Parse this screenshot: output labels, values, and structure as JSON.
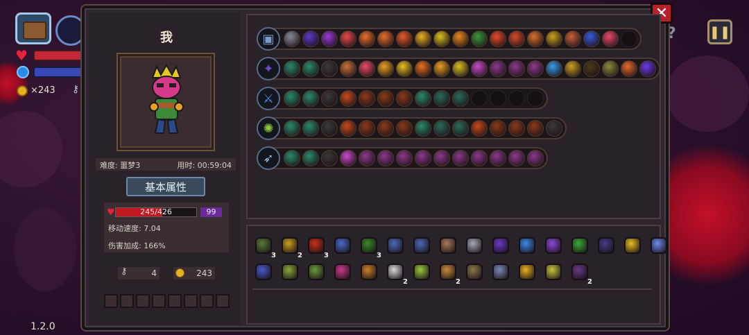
{
  "hud": {
    "coins": "×243",
    "version": "1.2.0"
  },
  "character": {
    "name": "我",
    "difficulty": "难度: 噩梦3",
    "time": "用时: 00:59:04",
    "stats_button": "基本属性",
    "hp": "245/426",
    "hp_fraction": 0.575,
    "shield": "99",
    "move_speed": "移动速度: 7.04",
    "damage_bonus": "伤害加成: 166%",
    "keys": "4",
    "coins": "243"
  },
  "weapon_rows": [
    {
      "weapon_icon": "chest-icon",
      "weapon_color": "#7a9ac8",
      "mods": [
        "#8a8a9a",
        "#5a3ac8",
        "#9a3ad8",
        "#e84a4a",
        "#e8702a",
        "#e8702a",
        "#e85a2a",
        "#e8b020",
        "#d8c020",
        "#e88a20",
        "#3a9a3a",
        "#e84a2a",
        "#d84a2a",
        "#d8702a",
        "#c8a020",
        "#c8603a",
        "#3a5ad8",
        "#e84a6a",
        "#141014"
      ]
    },
    {
      "weapon_icon": "staff-icon",
      "weapon_color": "#6a4ac8",
      "mods": [
        "#2a8a6a",
        "#2a8a6a",
        "#3a3a3a",
        "#c8703a",
        "#e84a6a",
        "#e8a020",
        "#e8c020",
        "#e87020",
        "#e8a020",
        "#d8c020",
        "#c84ac8",
        "#8a3a8a",
        "#8a3a8a",
        "#8a3a8a",
        "#3a9ae8",
        "#c8a020",
        "#4a3a1a",
        "#8a8a3a",
        "#e86a2a",
        "#6a3ae8"
      ]
    },
    {
      "weapon_icon": "sword-icon",
      "weapon_color": "#4a8ae8",
      "mods": [
        "#2a8a6a",
        "#2a8a6a",
        "#3a3a3a",
        "#c84a1a",
        "#8a3a1a",
        "#8a3a1a",
        "#8a3a1a",
        "#2a8a6a",
        "#2a6a5a",
        "#2a6a5a",
        "#141014",
        "#141014",
        "#141014",
        "#141014"
      ]
    },
    {
      "weapon_icon": "scepter-icon",
      "weapon_color": "#8ac83a",
      "mods": [
        "#2a8a6a",
        "#2a8a6a",
        "#3a3a3a",
        "#c84a1a",
        "#8a3a1a",
        "#8a3a1a",
        "#8a3a1a",
        "#2a8a6a",
        "#2a6a5a",
        "#2a6a5a",
        "#c84a1a",
        "#8a3a1a",
        "#8a3a1a",
        "#8a3a1a",
        "#3a3a3a"
      ]
    },
    {
      "weapon_icon": "blade-icon",
      "weapon_color": "#8ac8e8",
      "mods": [
        "#2a8a6a",
        "#2a8a6a",
        "#3a3a3a",
        "#c84ac8",
        "#8a3a8a",
        "#8a3a8a",
        "#8a3a8a",
        "#8a3a8a",
        "#8a3a8a",
        "#8a3a8a",
        "#8a3a8a",
        "#8a3a8a",
        "#8a3a8a",
        "#8a3a8a"
      ]
    }
  ],
  "bag": {
    "row1": [
      {
        "name": "skull-mask-icon",
        "color": "#5a7a3a",
        "count": "3"
      },
      {
        "name": "pickaxe-icon",
        "color": "#c8a020",
        "count": "2"
      },
      {
        "name": "demon-mask-icon",
        "color": "#c8301a",
        "count": "3"
      },
      {
        "name": "crystal-icon",
        "color": "#4a6ac8",
        "count": ""
      },
      {
        "name": "green-cloth-icon",
        "color": "#3a8a2a",
        "count": "3"
      },
      {
        "name": "gem-ring-icon",
        "color": "#4a6ab8",
        "count": ""
      },
      {
        "name": "wand-icon",
        "color": "#4a6ab8",
        "count": ""
      },
      {
        "name": "stone-icon",
        "color": "#a87a5a",
        "count": ""
      },
      {
        "name": "ribcage-icon",
        "color": "#a8a8b8",
        "count": ""
      },
      {
        "name": "wizard-hat-icon",
        "color": "#6a3ac8",
        "count": ""
      },
      {
        "name": "syringe-icon",
        "color": "#3a8ae8",
        "count": ""
      },
      {
        "name": "boot-icon",
        "color": "#8a4ad8",
        "count": ""
      },
      {
        "name": "leaf-icon",
        "color": "#3aaa3a",
        "count": ""
      },
      {
        "name": "cage-icon",
        "color": "#4a3a8a",
        "count": ""
      },
      {
        "name": "potion-icon",
        "color": "#e8c020",
        "count": ""
      },
      {
        "name": "key-scroll-icon",
        "color": "#6a8ae8",
        "count": ""
      }
    ],
    "row2": [
      {
        "name": "squid-icon",
        "color": "#4a5ac8",
        "count": ""
      },
      {
        "name": "eye-icon",
        "color": "#8aa83a",
        "count": ""
      },
      {
        "name": "claw-icon",
        "color": "#6a9a3a",
        "count": ""
      },
      {
        "name": "flame-mask-icon",
        "color": "#c83a8a",
        "count": ""
      },
      {
        "name": "scroll-icon",
        "color": "#c8802a",
        "count": ""
      },
      {
        "name": "teeth-icon",
        "color": "#d8d8d8",
        "count": "2"
      },
      {
        "name": "horn-icon",
        "color": "#9ac83a",
        "count": ""
      },
      {
        "name": "map-icon",
        "color": "#c88a3a",
        "count": "2"
      },
      {
        "name": "spider-icon",
        "color": "#8a7a4a",
        "count": ""
      },
      {
        "name": "arrow-icon",
        "color": "#7a8ab8",
        "count": ""
      },
      {
        "name": "bell-icon",
        "color": "#e8b020",
        "count": ""
      },
      {
        "name": "claw-pair-icon",
        "color": "#c8c83a",
        "count": ""
      },
      {
        "name": "robe-icon",
        "color": "#6a3a8a",
        "count": "2"
      }
    ]
  }
}
